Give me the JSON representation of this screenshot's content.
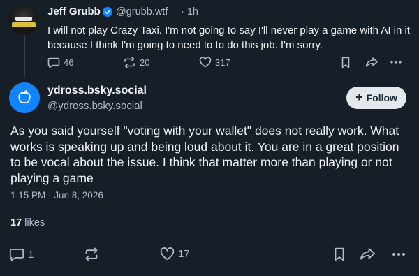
{
  "parent_post": {
    "author_name": "Jeff Grubb",
    "handle": "@grubb.wtf",
    "time": "· 1h",
    "text": "I will not play Crazy Taxi. I'm not going to say I'll never play a game with AI in it because I think I'm going to need to to do this job. I'm sorry.",
    "replies": "46",
    "reposts": "20",
    "likes": "317",
    "avatar_icon": "profile-photo"
  },
  "main_post": {
    "author_name": "ydross.bsky.social",
    "handle": "@ydross.bsky.social",
    "follow_label": "Follow",
    "text": "As you said yourself \"voting with your wallet\" does not really work. What works is speaking up and being loud about it. You are in a great position to be vocal about the issue. I think that matter more than playing or not playing a game",
    "timestamp": "1:15 PM · Jun 8, 2026",
    "likes_count": "17",
    "likes_label": "likes",
    "replies": "1",
    "likes_action": "17",
    "avatar_icon": "default-avatar-icon"
  },
  "colors": {
    "background": "#161e27",
    "accent": "#1083fe",
    "text": "#f1f3f5",
    "muted": "#aebbc9",
    "divider": "#2e4052"
  }
}
